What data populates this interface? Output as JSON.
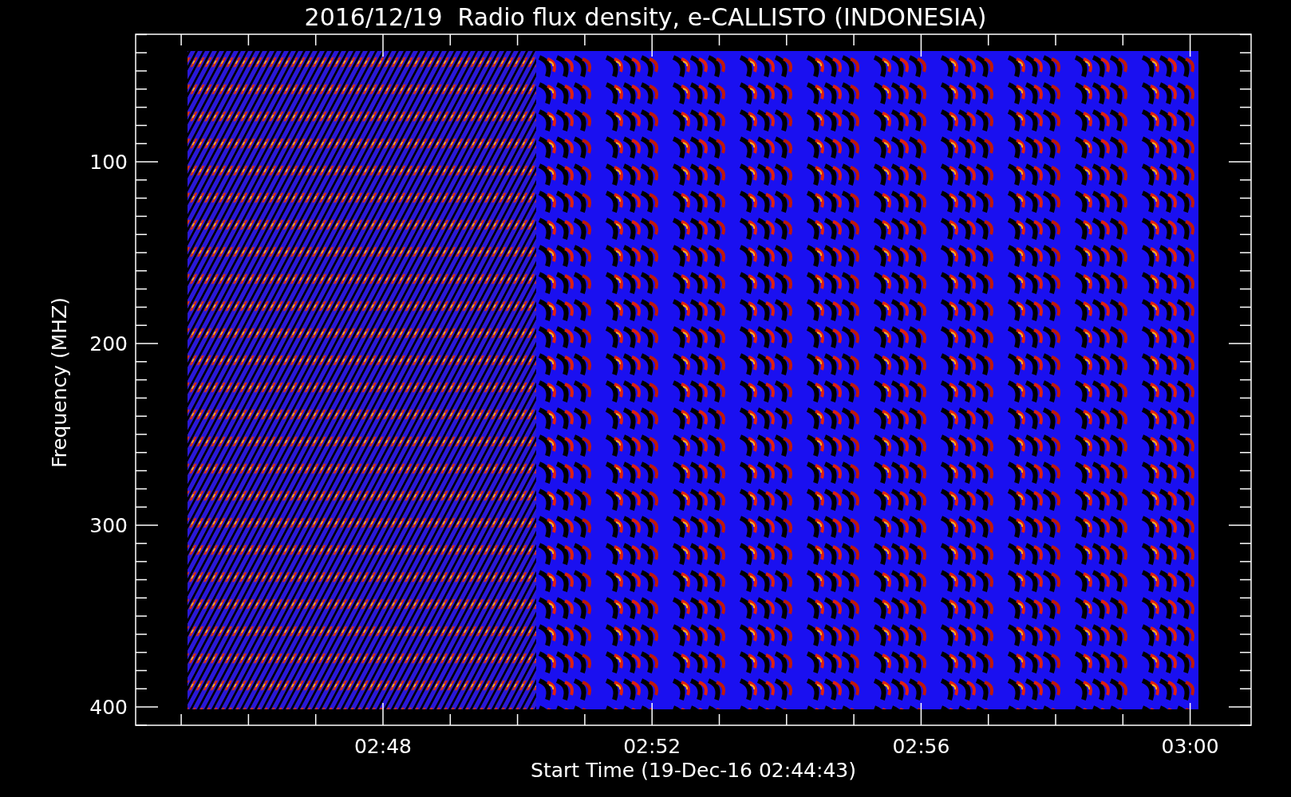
{
  "title": "2016/12/19  Radio flux density, e-CALLISTO (INDONESIA)",
  "plot": {
    "xlabel": "Start Time (19-Dec-16 02:44:43)",
    "ylabel": "Frequency (MHZ)",
    "xtick_labels": [
      "02:48",
      "02:52",
      "02:56",
      "03:00"
    ],
    "ytick_labels": [
      "100",
      "200",
      "300",
      "400"
    ]
  }
}
